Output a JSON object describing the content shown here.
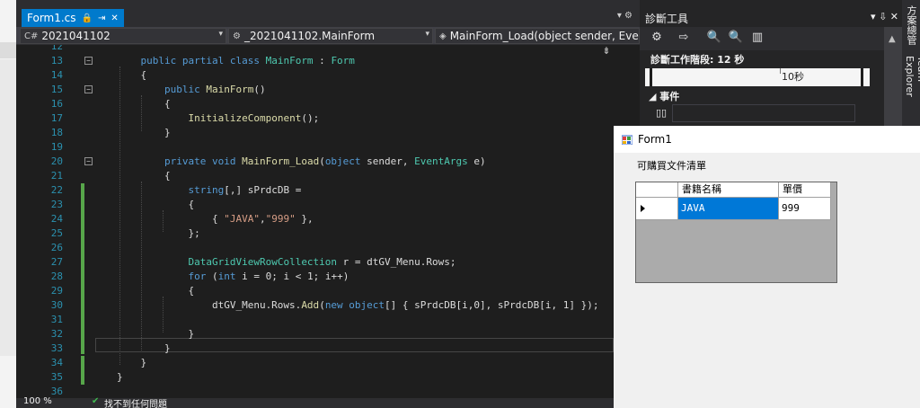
{
  "tab": {
    "label": "Form1.cs",
    "pin": "⊕",
    "close": "✕"
  },
  "navbar": {
    "project": "2021041102",
    "class": "_2021041102.MainForm",
    "member": "MainForm_Load(object sender, Event"
  },
  "code_lines": [
    {
      "num": "12",
      "html": ""
    },
    {
      "num": "13",
      "html": "    <span class='kw'>public partial class</span> <span class='ty'>MainForm</span> : <span class='ty'>Form</span>"
    },
    {
      "num": "14",
      "html": "    {"
    },
    {
      "num": "15",
      "html": "        <span class='kw'>public</span> <span class='fn'>MainForm</span>()"
    },
    {
      "num": "16",
      "html": "        {"
    },
    {
      "num": "17",
      "html": "            <span class='fn'>InitializeComponent</span>();"
    },
    {
      "num": "18",
      "html": "        }"
    },
    {
      "num": "19",
      "html": ""
    },
    {
      "num": "20",
      "html": "        <span class='kw'>private void</span> <span class='fn'>MainForm_Load</span>(<span class='kw'>object</span> sender, <span class='ty'>EventArgs</span> e)"
    },
    {
      "num": "21",
      "html": "        {"
    },
    {
      "num": "22",
      "html": "            <span class='kw'>string</span>[,] sPrdcDB ="
    },
    {
      "num": "23",
      "html": "            {"
    },
    {
      "num": "24",
      "html": "                { <span class='st'>\"JAVA\"</span>,<span class='st'>\"999\"</span> },"
    },
    {
      "num": "25",
      "html": "            };"
    },
    {
      "num": "26",
      "html": ""
    },
    {
      "num": "27",
      "html": "            <span class='ty'>DataGridViewRowCollection</span> r = dtGV_Menu.Rows;"
    },
    {
      "num": "28",
      "html": "            <span class='kw'>for</span> (<span class='kw'>int</span> i = 0; i &lt; 1; i++)"
    },
    {
      "num": "29",
      "html": "            {"
    },
    {
      "num": "30",
      "html": "                dtGV_Menu.Rows.<span class='fn'>Add</span>(<span class='kw'>new object</span>[] { sPrdcDB[i,0], sPrdcDB[i, 1] });"
    },
    {
      "num": "31",
      "html": ""
    },
    {
      "num": "32",
      "html": "            }"
    },
    {
      "num": "33",
      "html": "        }"
    },
    {
      "num": "34",
      "html": "    }"
    },
    {
      "num": "35",
      "html": "}"
    },
    {
      "num": "36",
      "html": ""
    }
  ],
  "status": {
    "zoom": "100 %",
    "issues": "找不到任何問題"
  },
  "diag": {
    "title": "診斷工具",
    "session": "診斷工作階段: 12 秒",
    "tick_label": "10秒",
    "events_label": "事件",
    "timeline_markers": [
      0.02,
      0.96
    ],
    "timeline_tick": 0.6
  },
  "side_tabs": [
    "方案總管",
    "Team Explorer"
  ],
  "form": {
    "title": "Form1",
    "label": "可購買文件清單",
    "columns": [
      "書籍名稱",
      "單價"
    ],
    "rows": [
      [
        "JAVA",
        "999"
      ]
    ]
  }
}
